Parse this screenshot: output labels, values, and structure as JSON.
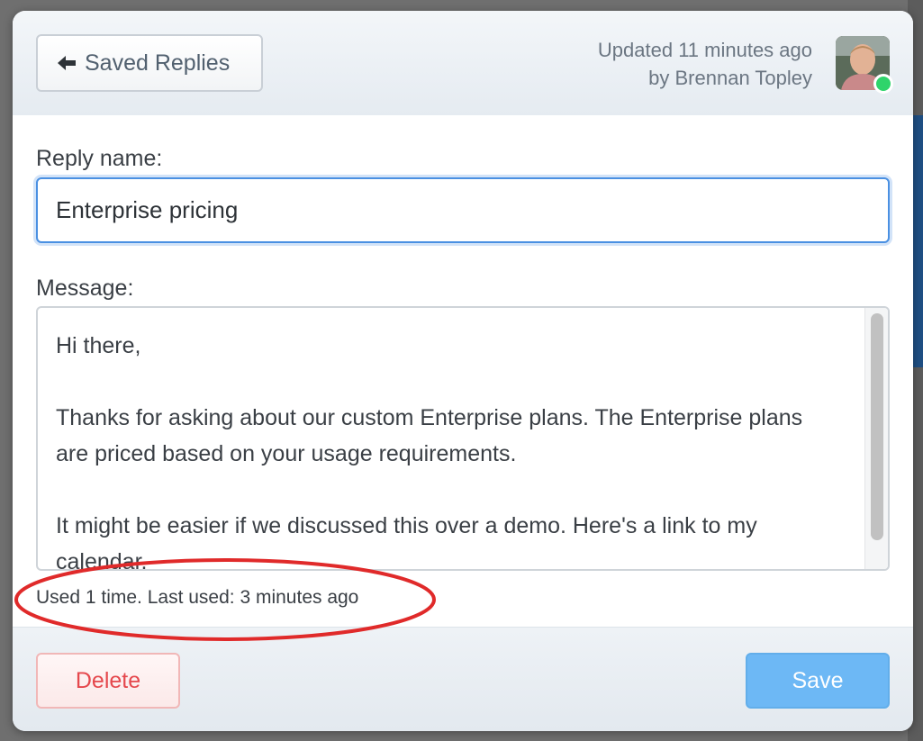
{
  "header": {
    "back_label": "Saved Replies",
    "updated_line1": "Updated 11 minutes ago",
    "updated_line2": "by Brennan Topley",
    "status": "online"
  },
  "form": {
    "name_label": "Reply name:",
    "name_value": "Enterprise pricing",
    "message_label": "Message:",
    "message_paragraphs": [
      "Hi there,",
      "Thanks for asking about our custom Enterprise plans. The Enterprise plans are priced based on your usage requirements.",
      "It might be easier if we discussed this over a demo. Here's a link to my calendar."
    ]
  },
  "usage": {
    "text": "Used 1 time.  Last used: 3 minutes ago"
  },
  "footer": {
    "delete_label": "Delete",
    "save_label": "Save"
  },
  "colors": {
    "accent": "#4a90e2",
    "delete": "#e5484d",
    "save": "#6db8f5",
    "annotation": "#e02a2a",
    "online": "#2fd46b"
  }
}
